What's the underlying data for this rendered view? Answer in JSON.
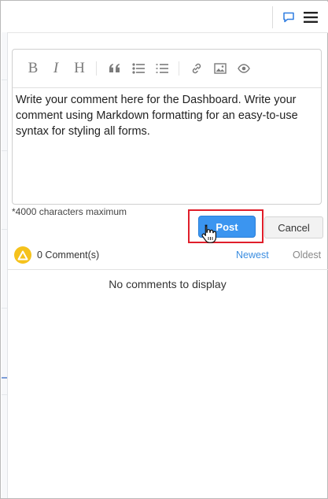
{
  "toolbar": {
    "bold_glyph": "B",
    "italic_glyph": "I",
    "heading_glyph": "H",
    "icons": [
      "bold-icon",
      "italic-icon",
      "heading-icon",
      "quote-icon",
      "unordered-list-icon",
      "ordered-list-icon",
      "link-icon",
      "image-icon",
      "preview-eye-icon"
    ]
  },
  "editor": {
    "content": "Write your comment here for the Dashboard. Write your comment using Markdown formatting for an easy-to-use syntax for styling all forms."
  },
  "char_limit": "*4000 characters maximum",
  "actions": {
    "post_label": "Post",
    "cancel_label": "Cancel"
  },
  "comments": {
    "count_label": "0 Comment(s)",
    "sort_newest": "Newest",
    "sort_oldest": "Oldest",
    "empty_message": "No comments to display"
  },
  "colors": {
    "accent": "#3b95f0",
    "highlight": "#e01e2a",
    "avatar": "#f5c21c"
  }
}
